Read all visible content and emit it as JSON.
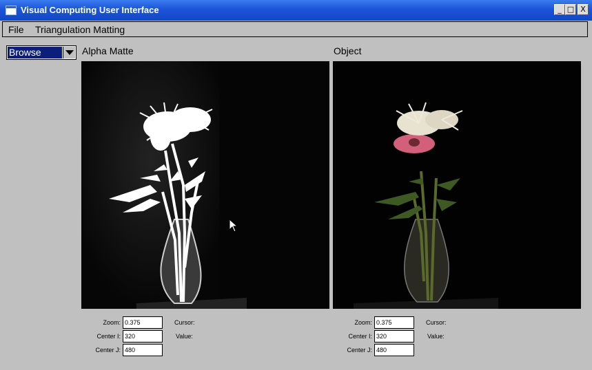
{
  "window": {
    "title": "Visual Computing User Interface",
    "controls": {
      "minimize": "_",
      "maximize": "□",
      "close": "X"
    }
  },
  "menu": {
    "items": [
      {
        "label": "File"
      },
      {
        "label": "Triangulation Matting"
      }
    ]
  },
  "mode_select": {
    "selected": "Browse"
  },
  "panels": {
    "alpha": {
      "title": "Alpha Matte",
      "zoom_label": "Zoom:",
      "zoom": "0.375",
      "center_i_label": "Center I:",
      "center_i": "320",
      "center_j_label": "Center J:",
      "center_j": "480",
      "cursor_label": "Cursor:",
      "value_label": "Value:"
    },
    "object": {
      "title": "Object",
      "zoom_label": "Zoom:",
      "zoom": "0.375",
      "center_i_label": "Center I:",
      "center_i": "320",
      "center_j_label": "Center J:",
      "center_j": "480",
      "cursor_label": "Cursor:",
      "value_label": "Value:"
    }
  },
  "colors": {
    "titlebar": "#1b54d8",
    "background": "#c0c0c0",
    "select_highlight": "#0a1e7a",
    "image_background": "#040404"
  }
}
